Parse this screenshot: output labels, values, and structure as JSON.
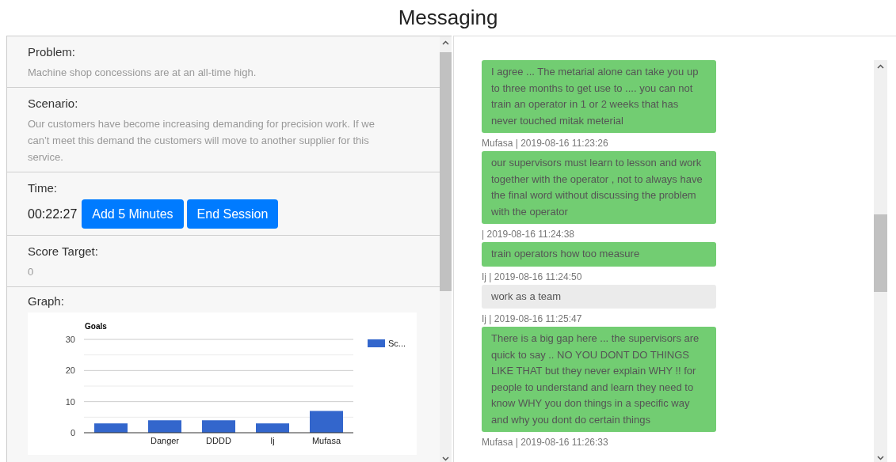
{
  "title": "Messaging",
  "info_panel": {
    "sections": [
      {
        "kind": "text",
        "label": "Problem:",
        "value": "Machine shop concessions are at an all-time high."
      },
      {
        "kind": "text",
        "label": "Scenario:",
        "value": "Our customers have become increasing demanding for precision work. If we can’t meet this demand the customers will move to another supplier for this service."
      },
      {
        "kind": "timer",
        "label": "Time:",
        "value": "00:22:27",
        "buttons": [
          "Add 5 Minutes",
          "End Session"
        ]
      },
      {
        "kind": "text",
        "label": "Score Target:",
        "value": "0"
      },
      {
        "kind": "chart",
        "label": "Graph:",
        "chart_data": {
          "type": "bar",
          "title": "Goals",
          "categories": [
            null,
            "Danger",
            "DDDD",
            "Ij",
            "Mufasa"
          ],
          "series": [
            {
              "name": "Sc...",
              "color": "#3366cc",
              "values": [
                3,
                4,
                4,
                3,
                7
              ]
            }
          ],
          "ylim": [
            0,
            30
          ],
          "yticks": [
            0,
            10,
            20,
            30
          ]
        }
      }
    ]
  },
  "messages": [
    {
      "text": "I agree ... The metarial alone can take you up to three months to get use to .... you can not train an operator in 1 or 2 weeks that has never touched mitak meterial",
      "color": "#72cd72"
    },
    {
      "meta": "Mufasa | 2019-08-16 11:23:26",
      "text": "our supervisors must learn to lesson and work together with the operator , not to always have the final word without discussing the problem with the operator",
      "color": "#72cd72"
    },
    {
      "meta": "| 2019-08-16 11:24:38",
      "text": "train operators how too measure",
      "color": "#72cd72"
    },
    {
      "meta": "Ij | 2019-08-16 11:24:50",
      "text": "work as a team",
      "color": "#ebebeb"
    },
    {
      "meta": "Ij | 2019-08-16 11:25:47",
      "text": "There is a big gap here ... the supervisors are quick to say .. NO YOU DONT DO THINGS LIKE THAT but they never explain WHY !! for people to understand and learn they need to know WHY you don things in a specific way and why you dont do certain things",
      "color": "#72cd72"
    },
    {
      "meta": "Mufasa | 2019-08-16 11:26:33"
    }
  ]
}
